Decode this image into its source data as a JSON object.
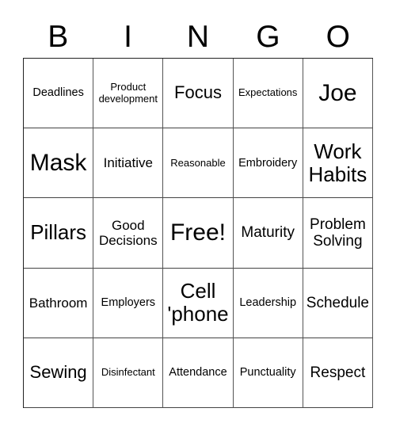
{
  "header": {
    "letters": [
      "B",
      "I",
      "N",
      "G",
      "O"
    ]
  },
  "board": {
    "rows": [
      [
        "Deadlines",
        "Product development",
        "Focus",
        "Expectations",
        "Joe"
      ],
      [
        "Mask",
        "Initiative",
        "Reasonable",
        "Embroidery",
        "Work Habits"
      ],
      [
        "Pillars",
        "Good Decisions",
        "Free!",
        "Maturity",
        "Problem Solving"
      ],
      [
        "Bathroom",
        "Employers",
        "Cell 'phone",
        "Leadership",
        "Schedule"
      ],
      [
        "Sewing",
        "Disinfectant",
        "Attendance",
        "Punctuality",
        "Respect"
      ]
    ]
  }
}
